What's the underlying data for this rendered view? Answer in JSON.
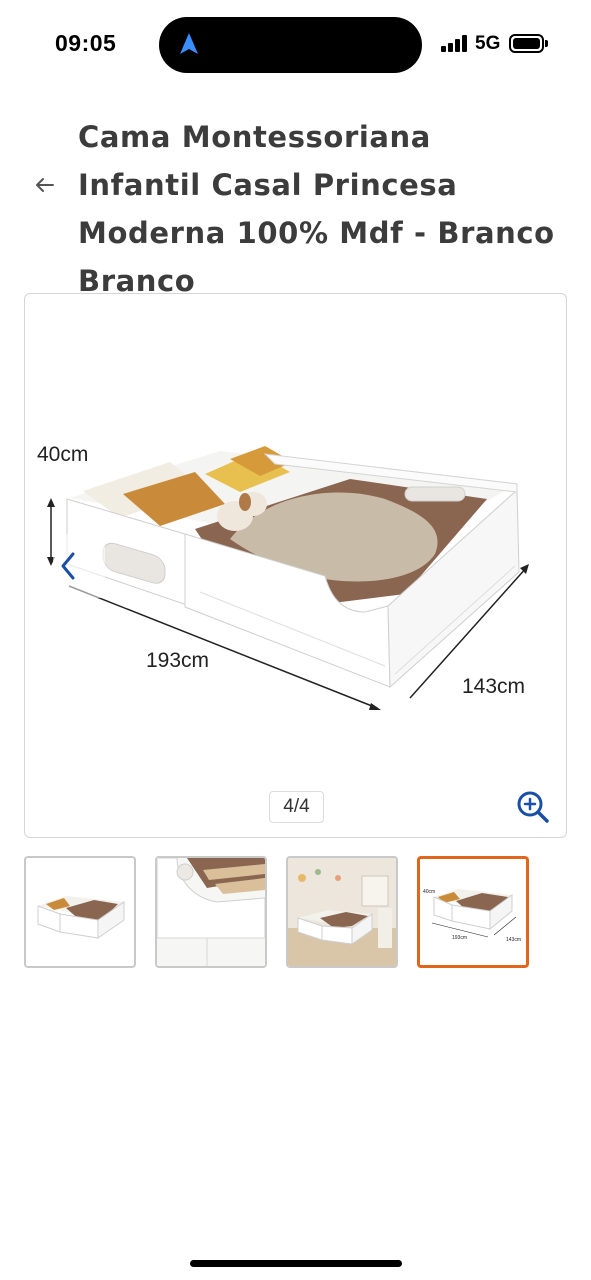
{
  "status_bar": {
    "time": "09:05",
    "network": "5G",
    "icons": [
      "location-arrow-icon",
      "signal-icon",
      "battery-icon"
    ]
  },
  "header": {
    "back_icon": "arrow-left-icon",
    "title": "Cama Montessoriana Infantil Casal Princesa Moderna 100% Mdf - Branco Branco"
  },
  "gallery": {
    "dimensions": {
      "height": "40cm",
      "length": "193cm",
      "width": "143cm"
    },
    "counter": "4/4",
    "prev_icon": "chevron-left-icon",
    "zoom_icon": "zoom-in-icon"
  },
  "thumbnails": [
    {
      "label": "bed-white-angle",
      "selected": false
    },
    {
      "label": "bed-slats-closeup",
      "selected": false
    },
    {
      "label": "bed-bedroom-scene",
      "selected": false
    },
    {
      "label": "bed-dimensions",
      "selected": true,
      "dims": {
        "height": "40cm",
        "length": "193cm",
        "width": "143cm"
      }
    }
  ],
  "colors": {
    "accent_selected": "#e1661c",
    "link_blue": "#1a4fa8",
    "title_text": "#3c3c3c"
  }
}
